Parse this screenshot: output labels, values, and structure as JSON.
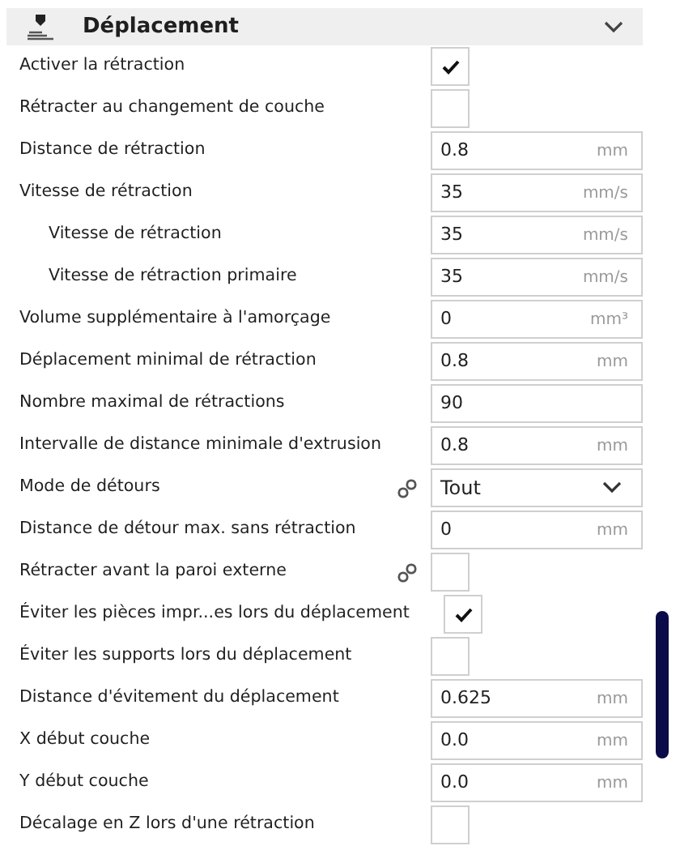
{
  "section": {
    "title": "Déplacement",
    "expanded": true
  },
  "settings": [
    {
      "kind": "checkbox",
      "label": "Activer la rétraction",
      "checked": true
    },
    {
      "kind": "checkbox",
      "label": "Rétracter au changement de couche",
      "checked": false
    },
    {
      "kind": "number",
      "label": "Distance de rétraction",
      "value": "0.8",
      "unit": "mm"
    },
    {
      "kind": "number",
      "label": "Vitesse de rétraction",
      "value": "35",
      "unit": "mm/s"
    },
    {
      "kind": "number",
      "label": "Vitesse de rétraction",
      "value": "35",
      "unit": "mm/s",
      "children_level": true
    },
    {
      "kind": "number",
      "label": "Vitesse de rétraction primaire",
      "value": "35",
      "unit": "mm/s",
      "children_level": true
    },
    {
      "kind": "number",
      "label": "Volume supplémentaire à l'amorçage",
      "value": "0",
      "unit": "mm³"
    },
    {
      "kind": "number",
      "label": "Déplacement minimal de rétraction",
      "value": "0.8",
      "unit": "mm"
    },
    {
      "kind": "number",
      "label": "Nombre maximal de rétractions",
      "value": "90"
    },
    {
      "kind": "number",
      "label": "Intervalle de distance minimale d'extrusion",
      "value": "0.8",
      "unit": "mm"
    },
    {
      "kind": "select",
      "label": "Mode de détours",
      "value": "Tout",
      "linked": true
    },
    {
      "kind": "number",
      "label": "Distance de détour max. sans rétraction",
      "value": "0",
      "unit": "mm"
    },
    {
      "kind": "checkbox",
      "label": "Rétracter avant la paroi externe",
      "checked": false,
      "linked": true
    },
    {
      "kind": "checkbox",
      "label": "Éviter les pièces impr...es lors du déplacement",
      "checked": true
    },
    {
      "kind": "checkbox",
      "label": "Éviter les supports lors du déplacement",
      "checked": false
    },
    {
      "kind": "number",
      "label": "Distance d'évitement du déplacement",
      "value": "0.625",
      "unit": "mm"
    },
    {
      "kind": "number",
      "label": "X début couche",
      "value": "0.0",
      "unit": "mm"
    },
    {
      "kind": "number",
      "label": "Y début couche",
      "value": "0.0",
      "unit": "mm"
    },
    {
      "kind": "checkbox",
      "label": "Décalage en Z lors d'une rétraction",
      "checked": false
    }
  ]
}
